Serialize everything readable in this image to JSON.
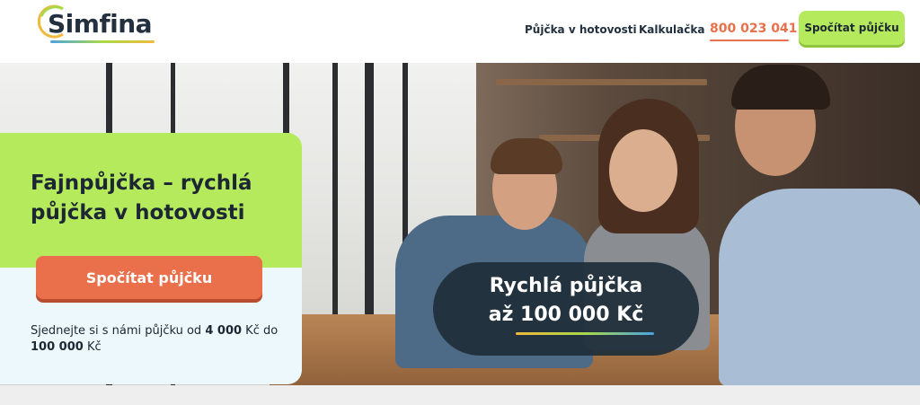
{
  "header": {
    "logo_text": "Simfina",
    "nav_loan": "Půjčka v hotovosti",
    "nav_calc": "Kalkulačka",
    "phone": "800 023 041",
    "cta_label": "Spočítat půjčku"
  },
  "hero": {
    "headline_line1": "Fajnpůjčka – rychlá",
    "headline_line2": "půjčka v hotovosti",
    "cta_label": "Spočítat půjčku",
    "sub_part1": "Sjednejte si s námi půjčku od ",
    "sub_min": "4 000",
    "sub_part2": " Kč do",
    "sub_max": "100 000",
    "sub_part3": " Kč",
    "badge_line1": "Rychlá půjčka",
    "badge_line2": "až 100 000 Kč"
  },
  "colors": {
    "accent_green": "#b5ea5c",
    "accent_orange": "#e9704b",
    "dark": "#1c2733"
  }
}
